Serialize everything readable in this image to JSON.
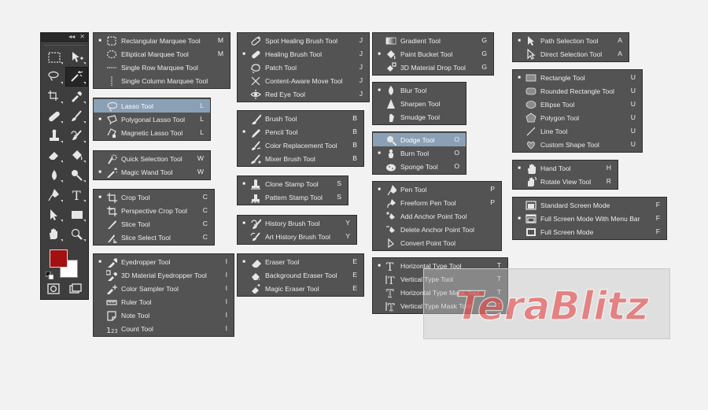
{
  "toolbar": {
    "collapse_glyph": "◂◂",
    "close_glyph": "✕",
    "tools": [
      {
        "name": "marquee-tool-button",
        "icon": "marquee-icon",
        "active": false
      },
      {
        "name": "move-tool-button",
        "icon": "move-icon",
        "active": false
      },
      {
        "name": "lasso-tool-button",
        "icon": "lasso-icon",
        "active": false
      },
      {
        "name": "magic-wand-tool-button",
        "icon": "magic-wand-icon",
        "active": true
      },
      {
        "name": "crop-tool-button",
        "icon": "crop-icon",
        "active": false
      },
      {
        "name": "eyedropper-tool-button",
        "icon": "eyedropper-icon",
        "active": false
      },
      {
        "name": "healing-brush-tool-button",
        "icon": "bandage-icon",
        "active": false
      },
      {
        "name": "brush-tool-button",
        "icon": "brush-icon",
        "active": false
      },
      {
        "name": "clone-stamp-tool-button",
        "icon": "stamp-icon",
        "active": false
      },
      {
        "name": "history-brush-tool-button",
        "icon": "history-brush-icon",
        "active": false
      },
      {
        "name": "eraser-tool-button",
        "icon": "eraser-icon",
        "active": false
      },
      {
        "name": "paint-bucket-tool-button",
        "icon": "bucket-icon",
        "active": false
      },
      {
        "name": "blur-tool-button",
        "icon": "drop-icon",
        "active": false
      },
      {
        "name": "dodge-tool-button",
        "icon": "dodge-icon",
        "active": false
      },
      {
        "name": "pen-tool-button",
        "icon": "pen-icon",
        "active": false
      },
      {
        "name": "type-tool-button",
        "icon": "type-icon",
        "active": false
      },
      {
        "name": "path-selection-tool-button",
        "icon": "arrow-icon",
        "active": false
      },
      {
        "name": "rectangle-tool-button",
        "icon": "rectangle-icon",
        "active": false
      },
      {
        "name": "hand-tool-button",
        "icon": "hand-icon",
        "active": false
      },
      {
        "name": "zoom-tool-button",
        "icon": "zoom-icon",
        "active": false
      }
    ],
    "foreground_color": "#a40f0f",
    "background_color": "#ffffff"
  },
  "panels": [
    {
      "id": "marquee",
      "rows": [
        {
          "label": "Rectangular Marquee Tool",
          "key": "M",
          "icon": "rect-marquee-icon",
          "bullet": true,
          "selected": false
        },
        {
          "label": "Elliptical Marquee Tool",
          "key": "M",
          "icon": "ellipse-marquee-icon",
          "bullet": false,
          "selected": false
        },
        {
          "label": "Single Row Marquee Tool",
          "key": "",
          "icon": "single-row-marquee-icon",
          "bullet": false,
          "selected": false
        },
        {
          "label": "Single Column Marquee Tool",
          "key": "",
          "icon": "single-column-marquee-icon",
          "bullet": false,
          "selected": false
        }
      ]
    },
    {
      "id": "lasso",
      "rows": [
        {
          "label": "Lasso Tool",
          "key": "L",
          "icon": "lasso-icon",
          "bullet": false,
          "selected": true
        },
        {
          "label": "Polygonal Lasso Tool",
          "key": "L",
          "icon": "polygonal-lasso-icon",
          "bullet": true,
          "selected": false
        },
        {
          "label": "Magnetic Lasso Tool",
          "key": "L",
          "icon": "magnetic-lasso-icon",
          "bullet": false,
          "selected": false
        }
      ]
    },
    {
      "id": "quick-selection",
      "rows": [
        {
          "label": "Quick Selection Tool",
          "key": "W",
          "icon": "quick-selection-icon",
          "bullet": false,
          "selected": false
        },
        {
          "label": "Magic Wand Tool",
          "key": "W",
          "icon": "magic-wand-icon",
          "bullet": true,
          "selected": false
        }
      ]
    },
    {
      "id": "crop",
      "rows": [
        {
          "label": "Crop Tool",
          "key": "C",
          "icon": "crop-icon",
          "bullet": true,
          "selected": false
        },
        {
          "label": "Perspective Crop Tool",
          "key": "C",
          "icon": "perspective-crop-icon",
          "bullet": false,
          "selected": false
        },
        {
          "label": "Slice Tool",
          "key": "C",
          "icon": "slice-icon",
          "bullet": false,
          "selected": false
        },
        {
          "label": "Slice Select Tool",
          "key": "C",
          "icon": "slice-select-icon",
          "bullet": false,
          "selected": false
        }
      ]
    },
    {
      "id": "eyedropper",
      "rows": [
        {
          "label": "Eyedropper Tool",
          "key": "I",
          "icon": "eyedropper-icon",
          "bullet": true,
          "selected": false
        },
        {
          "label": "3D Material Eyedropper Tool",
          "key": "I",
          "icon": "3d-eyedropper-icon",
          "bullet": false,
          "selected": false
        },
        {
          "label": "Color Sampler Tool",
          "key": "I",
          "icon": "color-sampler-icon",
          "bullet": false,
          "selected": false
        },
        {
          "label": "Ruler Tool",
          "key": "I",
          "icon": "ruler-icon",
          "bullet": false,
          "selected": false
        },
        {
          "label": "Note Tool",
          "key": "I",
          "icon": "note-icon",
          "bullet": false,
          "selected": false
        },
        {
          "label": "Count Tool",
          "key": "I",
          "icon": "count-icon",
          "bullet": false,
          "selected": false
        }
      ]
    },
    {
      "id": "healing",
      "rows": [
        {
          "label": "Spot Healing Brush Tool",
          "key": "J",
          "icon": "spot-healing-icon",
          "bullet": false,
          "selected": false
        },
        {
          "label": "Healing Brush Tool",
          "key": "J",
          "icon": "healing-brush-icon",
          "bullet": true,
          "selected": false
        },
        {
          "label": "Patch Tool",
          "key": "J",
          "icon": "patch-icon",
          "bullet": false,
          "selected": false
        },
        {
          "label": "Content-Aware Move Tool",
          "key": "J",
          "icon": "content-aware-move-icon",
          "bullet": false,
          "selected": false
        },
        {
          "label": "Red Eye Tool",
          "key": "J",
          "icon": "red-eye-icon",
          "bullet": false,
          "selected": false
        }
      ]
    },
    {
      "id": "brush",
      "rows": [
        {
          "label": "Brush Tool",
          "key": "B",
          "icon": "brush-icon",
          "bullet": false,
          "selected": false
        },
        {
          "label": "Pencil Tool",
          "key": "B",
          "icon": "pencil-icon",
          "bullet": true,
          "selected": false
        },
        {
          "label": "Color Replacement Tool",
          "key": "B",
          "icon": "color-replacement-icon",
          "bullet": false,
          "selected": false
        },
        {
          "label": "Mixer Brush Tool",
          "key": "B",
          "icon": "mixer-brush-icon",
          "bullet": false,
          "selected": false
        }
      ]
    },
    {
      "id": "stamp",
      "rows": [
        {
          "label": "Clone Stamp Tool",
          "key": "S",
          "icon": "clone-stamp-icon",
          "bullet": true,
          "selected": false
        },
        {
          "label": "Pattern Stamp Tool",
          "key": "S",
          "icon": "pattern-stamp-icon",
          "bullet": false,
          "selected": false
        }
      ]
    },
    {
      "id": "history",
      "rows": [
        {
          "label": "History Brush Tool",
          "key": "Y",
          "icon": "history-brush-icon",
          "bullet": true,
          "selected": false
        },
        {
          "label": "Art History Brush Tool",
          "key": "Y",
          "icon": "art-history-brush-icon",
          "bullet": false,
          "selected": false
        }
      ]
    },
    {
      "id": "eraser",
      "rows": [
        {
          "label": "Eraser Tool",
          "key": "E",
          "icon": "eraser-icon",
          "bullet": true,
          "selected": false
        },
        {
          "label": "Background Eraser Tool",
          "key": "E",
          "icon": "background-eraser-icon",
          "bullet": false,
          "selected": false
        },
        {
          "label": "Magic Eraser Tool",
          "key": "E",
          "icon": "magic-eraser-icon",
          "bullet": false,
          "selected": false
        }
      ]
    },
    {
      "id": "gradient",
      "rows": [
        {
          "label": "Gradient Tool",
          "key": "G",
          "icon": "gradient-icon",
          "bullet": false,
          "selected": false
        },
        {
          "label": "Paint Bucket Tool",
          "key": "G",
          "icon": "paint-bucket-icon",
          "bullet": true,
          "selected": false
        },
        {
          "label": "3D Material Drop Tool",
          "key": "G",
          "icon": "3d-material-drop-icon",
          "bullet": false,
          "selected": false
        }
      ]
    },
    {
      "id": "blur",
      "rows": [
        {
          "label": "Blur Tool",
          "key": "",
          "icon": "blur-icon",
          "bullet": true,
          "selected": false
        },
        {
          "label": "Sharpen Tool",
          "key": "",
          "icon": "sharpen-icon",
          "bullet": false,
          "selected": false
        },
        {
          "label": "Smudge Tool",
          "key": "",
          "icon": "smudge-icon",
          "bullet": false,
          "selected": false
        }
      ]
    },
    {
      "id": "dodge",
      "rows": [
        {
          "label": "Dodge Tool",
          "key": "O",
          "icon": "dodge-icon",
          "bullet": false,
          "selected": true
        },
        {
          "label": "Burn Tool",
          "key": "O",
          "icon": "burn-icon",
          "bullet": true,
          "selected": false
        },
        {
          "label": "Sponge Tool",
          "key": "O",
          "icon": "sponge-icon",
          "bullet": false,
          "selected": false
        }
      ]
    },
    {
      "id": "pen",
      "rows": [
        {
          "label": "Pen Tool",
          "key": "P",
          "icon": "pen-icon",
          "bullet": true,
          "selected": false
        },
        {
          "label": "Freeform Pen Tool",
          "key": "P",
          "icon": "freeform-pen-icon",
          "bullet": false,
          "selected": false
        },
        {
          "label": "Add Anchor Point Tool",
          "key": "",
          "icon": "add-anchor-icon",
          "bullet": false,
          "selected": false
        },
        {
          "label": "Delete Anchor Point Tool",
          "key": "",
          "icon": "delete-anchor-icon",
          "bullet": false,
          "selected": false
        },
        {
          "label": "Convert Point Tool",
          "key": "",
          "icon": "convert-point-icon",
          "bullet": false,
          "selected": false
        }
      ]
    },
    {
      "id": "type",
      "rows": [
        {
          "label": "Horizontal Type Tool",
          "key": "T",
          "icon": "horizontal-type-icon",
          "bullet": true,
          "selected": false
        },
        {
          "label": "Vertical Type Tool",
          "key": "T",
          "icon": "vertical-type-icon",
          "bullet": false,
          "selected": false
        },
        {
          "label": "Horizontal Type Mask Tool",
          "key": "T",
          "icon": "horizontal-type-mask-icon",
          "bullet": false,
          "selected": false
        },
        {
          "label": "Vertical Type Mask Tool",
          "key": "T",
          "icon": "vertical-type-mask-icon",
          "bullet": false,
          "selected": false
        }
      ]
    },
    {
      "id": "path-selection",
      "rows": [
        {
          "label": "Path Selection Tool",
          "key": "A",
          "icon": "path-selection-icon",
          "bullet": true,
          "selected": false
        },
        {
          "label": "Direct Selection Tool",
          "key": "A",
          "icon": "direct-selection-icon",
          "bullet": false,
          "selected": false
        }
      ]
    },
    {
      "id": "shapes",
      "rows": [
        {
          "label": "Rectangle Tool",
          "key": "U",
          "icon": "rectangle-shape-icon",
          "bullet": true,
          "selected": false
        },
        {
          "label": "Rounded Rectangle Tool",
          "key": "U",
          "icon": "rounded-rectangle-icon",
          "bullet": false,
          "selected": false
        },
        {
          "label": "Ellipse Tool",
          "key": "U",
          "icon": "ellipse-icon",
          "bullet": false,
          "selected": false
        },
        {
          "label": "Polygon Tool",
          "key": "U",
          "icon": "polygon-icon",
          "bullet": false,
          "selected": false
        },
        {
          "label": "Line Tool",
          "key": "U",
          "icon": "line-icon",
          "bullet": false,
          "selected": false
        },
        {
          "label": "Custom Shape Tool",
          "key": "U",
          "icon": "custom-shape-icon",
          "bullet": false,
          "selected": false
        }
      ]
    },
    {
      "id": "hand",
      "rows": [
        {
          "label": "Hand Tool",
          "key": "H",
          "icon": "hand-icon",
          "bullet": true,
          "selected": false
        },
        {
          "label": "Rotate View Tool",
          "key": "R",
          "icon": "rotate-view-icon",
          "bullet": false,
          "selected": false
        }
      ]
    },
    {
      "id": "screen-mode",
      "rows": [
        {
          "label": "Standard Screen Mode",
          "key": "F",
          "icon": "standard-screen-icon",
          "bullet": false,
          "selected": false
        },
        {
          "label": "Full Screen Mode With Menu Bar",
          "key": "F",
          "icon": "full-screen-menu-icon",
          "bullet": true,
          "selected": false
        },
        {
          "label": "Full Screen Mode",
          "key": "F",
          "icon": "full-screen-icon",
          "bullet": false,
          "selected": false
        }
      ]
    }
  ],
  "watermark": {
    "text": "TeraBlitz",
    "color": "#e84848"
  },
  "colors": {
    "panel_bg": "#535353",
    "selected_row": "#8aa0b7",
    "text": "#ececec",
    "toolbar_bg": "#3e3e3e"
  }
}
